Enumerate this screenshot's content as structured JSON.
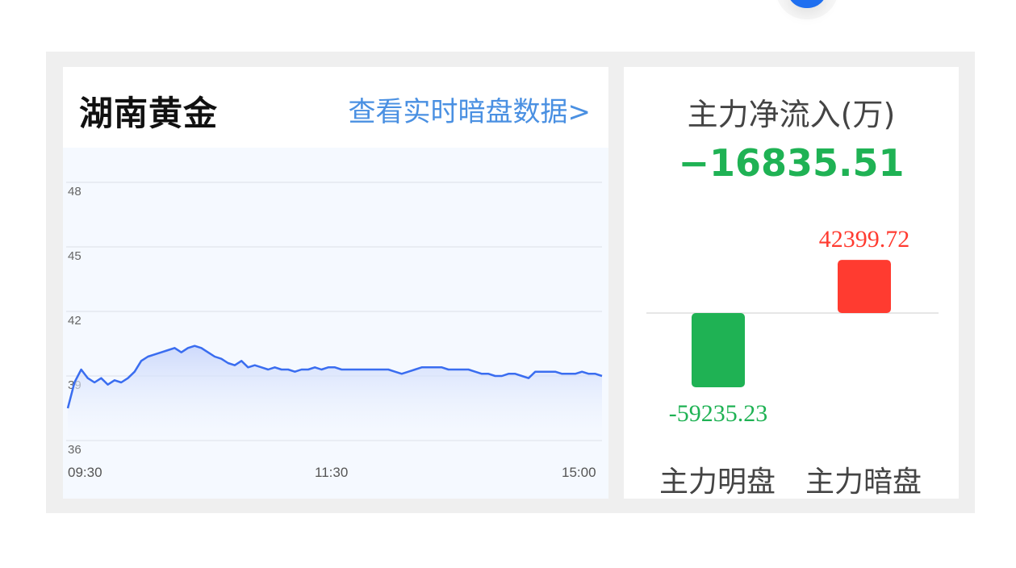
{
  "stock": {
    "name": "湖南黄金",
    "dark_link": "查看实时暗盘数据>"
  },
  "price_chart": {
    "y_ticks": [
      "48",
      "45",
      "42",
      "39",
      "36"
    ],
    "x_ticks": [
      "09:30",
      "11:30",
      "15:00"
    ]
  },
  "capital_flow": {
    "title": "主力净流入(万)",
    "net_value": "−16835.51",
    "positive_color": "#ff3b30",
    "negative_color": "#1fb254",
    "line_color": "#3a6df0"
  },
  "chart_data": [
    {
      "type": "line",
      "ylim": [
        36,
        48
      ],
      "yticks": [
        48,
        45,
        42,
        39,
        36
      ],
      "xtick_labels": [
        "09:30",
        "11:30",
        "15:00"
      ],
      "grid": true,
      "series": [
        {
          "values": [
            37.5,
            38.7,
            39.3,
            38.9,
            38.7,
            38.9,
            38.6,
            38.8,
            38.7,
            38.9,
            39.2,
            39.7,
            39.9,
            40.0,
            40.1,
            40.2,
            40.3,
            40.1,
            40.3,
            40.4,
            40.3,
            40.1,
            39.9,
            39.8,
            39.6,
            39.5,
            39.7,
            39.4,
            39.5,
            39.4,
            39.3,
            39.4,
            39.3,
            39.3,
            39.2,
            39.3,
            39.3,
            39.4,
            39.3,
            39.4,
            39.4,
            39.3,
            39.3,
            39.3,
            39.3,
            39.3,
            39.3,
            39.3,
            39.3,
            39.2,
            39.1,
            39.2,
            39.3,
            39.4,
            39.4,
            39.4,
            39.4,
            39.3,
            39.3,
            39.3,
            39.3,
            39.2,
            39.1,
            39.1,
            39.0,
            39.0,
            39.1,
            39.1,
            39.0,
            38.9,
            39.2,
            39.2,
            39.2,
            39.2,
            39.1,
            39.1,
            39.1,
            39.2,
            39.1,
            39.1,
            39.0
          ]
        }
      ]
    },
    {
      "type": "bar",
      "categories": [
        "主力明盘",
        "主力暗盘"
      ],
      "values": [
        -59235.23,
        42399.72
      ],
      "value_labels": [
        "-59235.23",
        "42399.72"
      ]
    }
  ]
}
